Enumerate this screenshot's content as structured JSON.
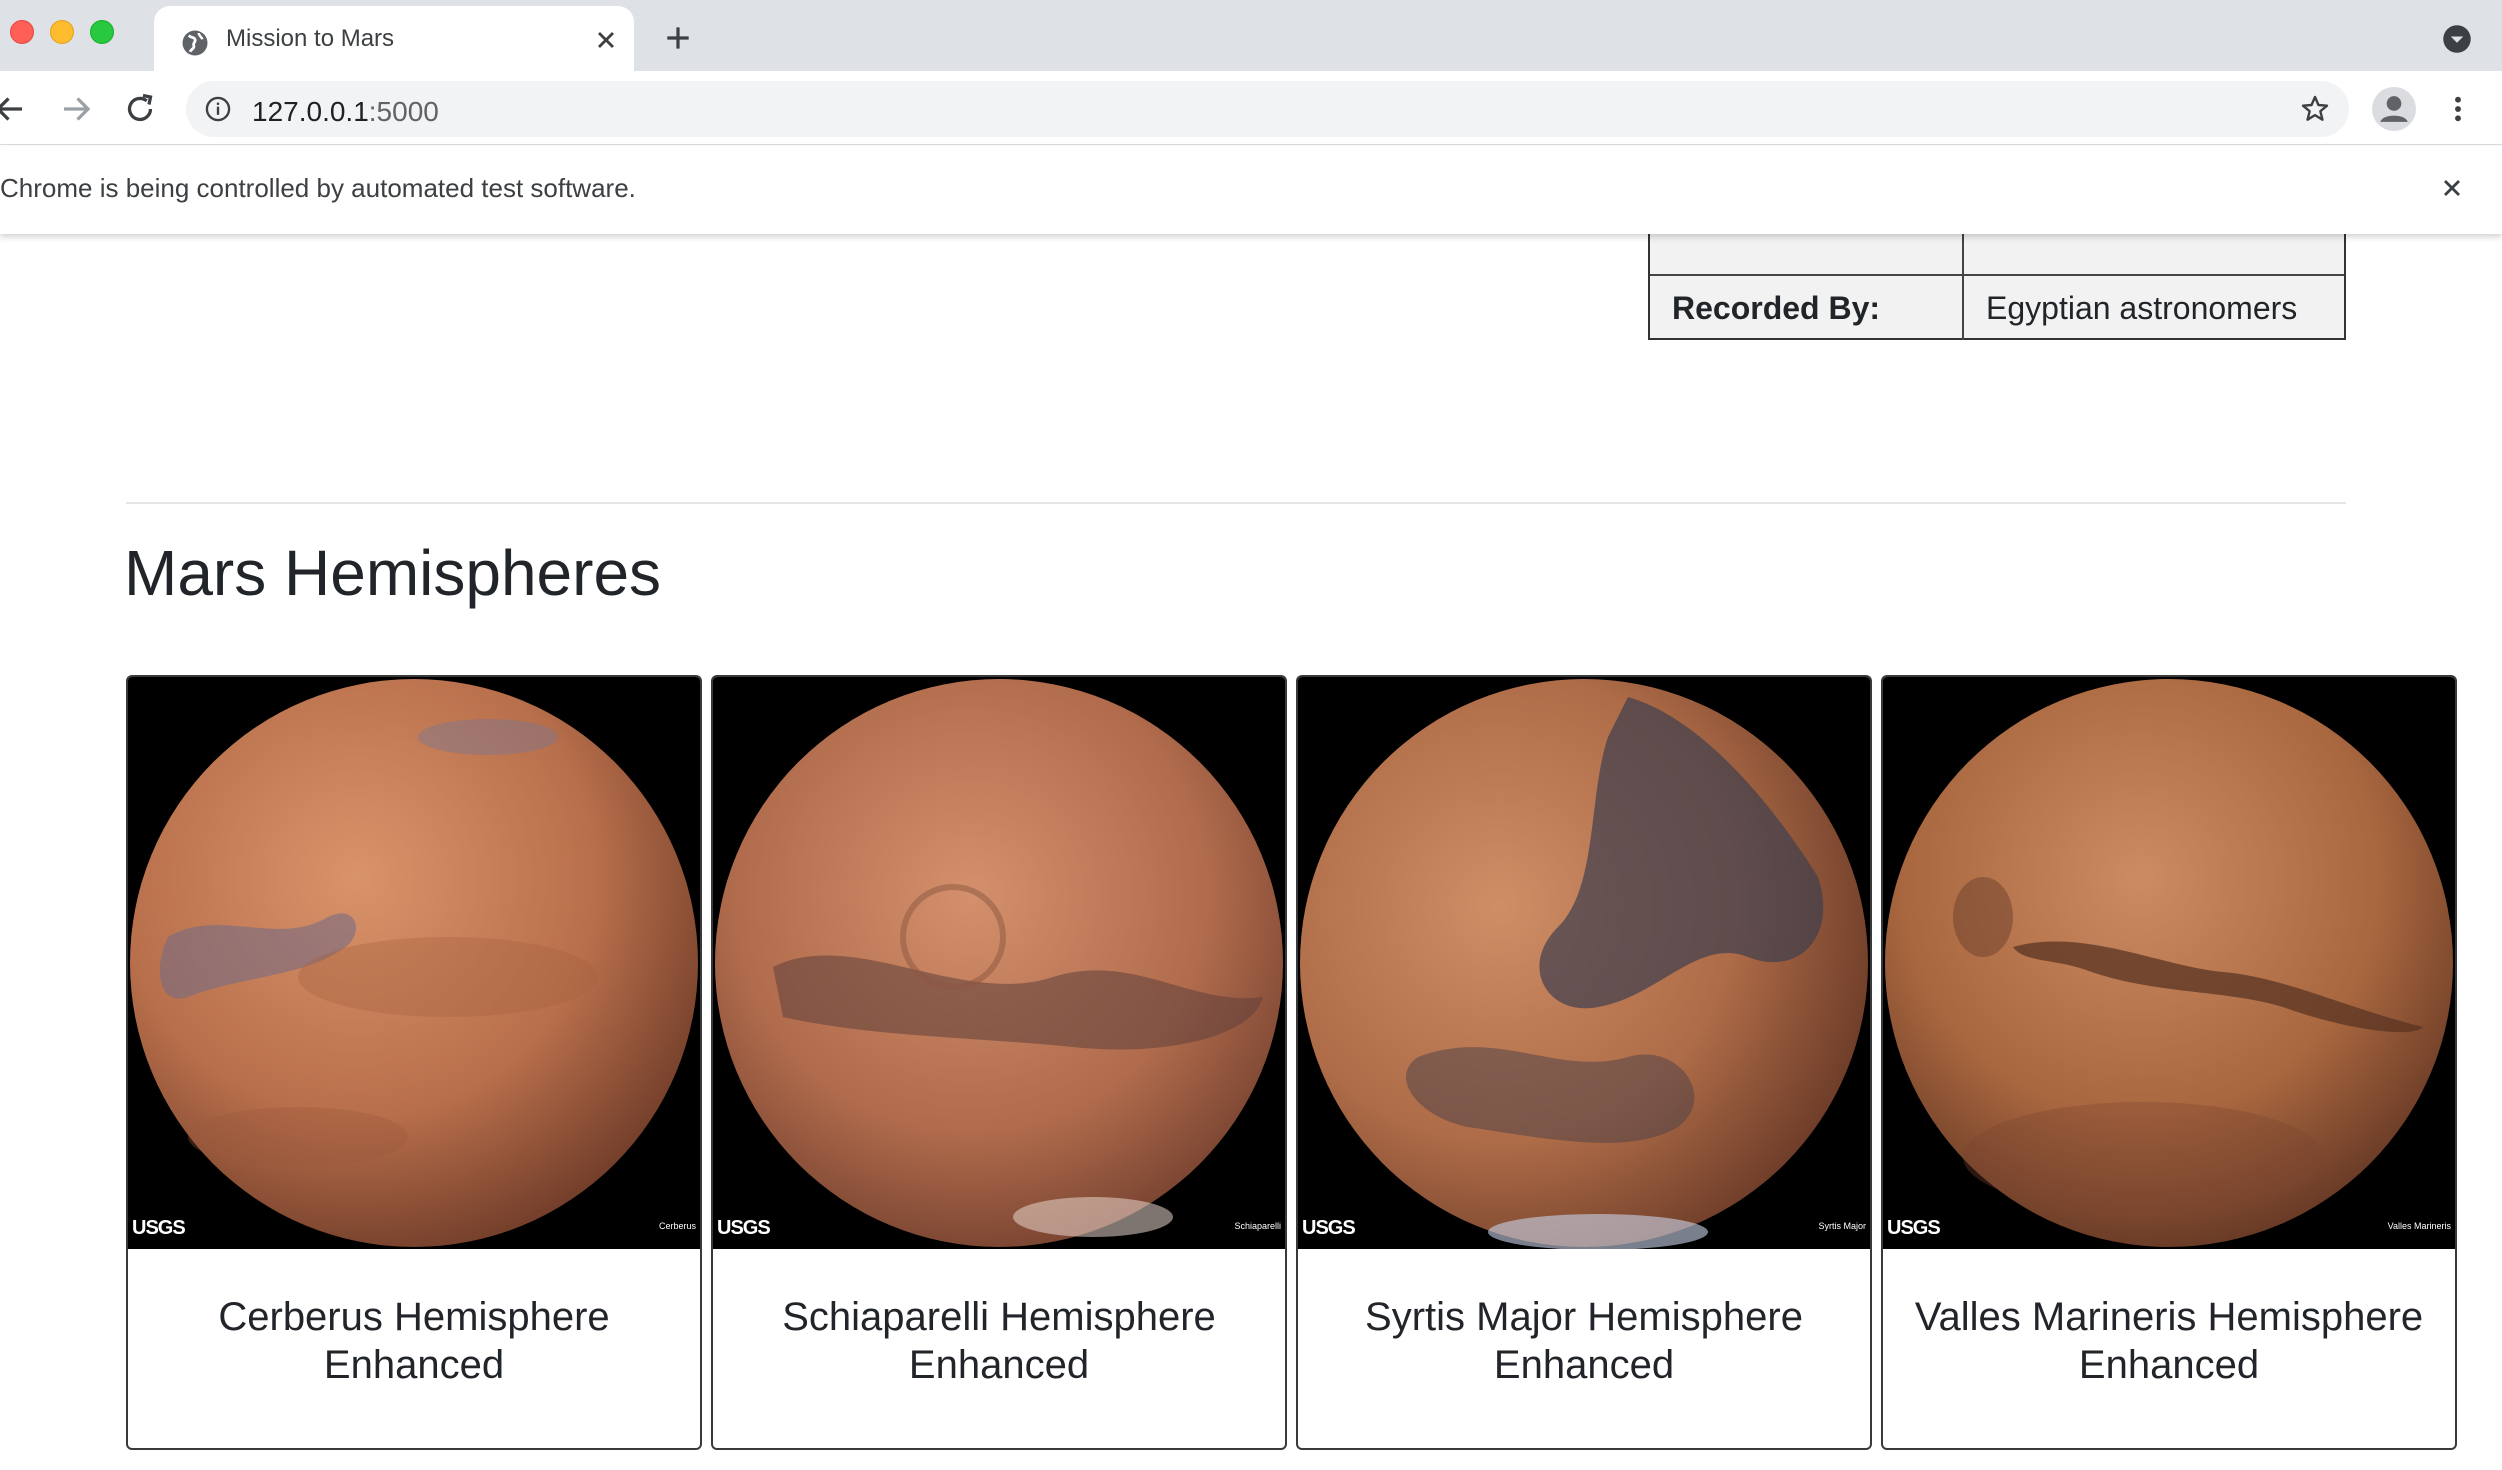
{
  "browser": {
    "tab_title": "Mission to Mars",
    "url_host": "127.0.0.1",
    "url_port": ":5000",
    "infobar_text": "Chrome is being controlled by automated test software."
  },
  "facts": {
    "label": "Recorded By:",
    "value": "Egyptian astronomers"
  },
  "section_title": "Mars Hemispheres",
  "hemispheres": [
    {
      "title": "Cerberus Hemisphere Enhanced",
      "credit": "USGS",
      "image_caption": "Cerberus"
    },
    {
      "title": "Schiaparelli Hemisphere Enhanced",
      "credit": "USGS",
      "image_caption": "Schiaparelli"
    },
    {
      "title": "Syrtis Major Hemisphere Enhanced",
      "credit": "USGS",
      "image_caption": "Syrtis Major"
    },
    {
      "title": "Valles Marineris Hemisphere Enhanced",
      "credit": "USGS",
      "image_caption": "Valles Marineris"
    }
  ],
  "icons": {
    "favicon": "globe-icon",
    "tab_close": "close-icon",
    "new_tab": "plus-icon",
    "tab_search": "chevron-down-icon",
    "back": "arrow-left-icon",
    "forward": "arrow-right-icon",
    "reload": "reload-icon",
    "site_info": "info-icon",
    "bookmark": "star-icon",
    "profile": "person-icon",
    "menu": "kebab-menu-icon",
    "infobar_close": "close-icon"
  },
  "colors": {
    "tabstrip": "#dee1e6",
    "omnibox": "#f1f3f4",
    "mars_base": "#b66b48",
    "mars_dark": "#5e3a33"
  }
}
